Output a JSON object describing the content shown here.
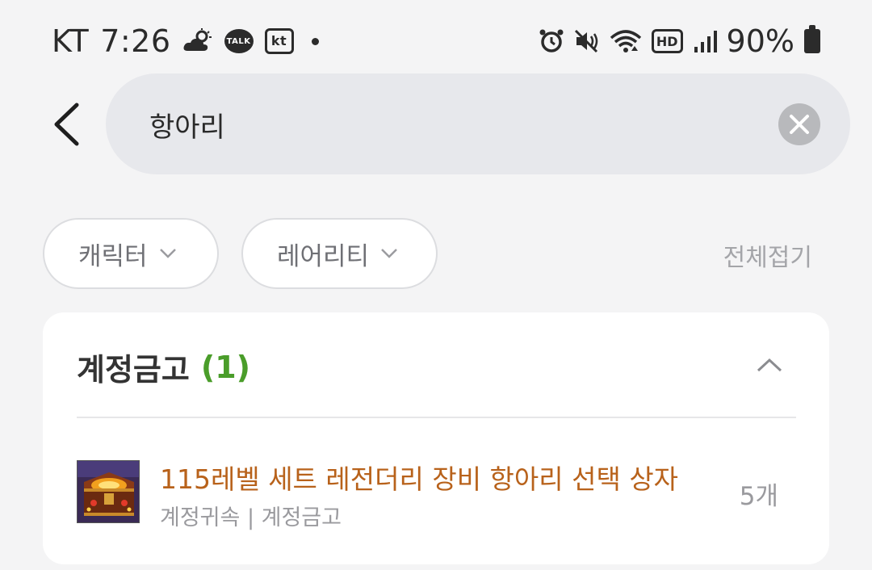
{
  "status_bar": {
    "carrier": "KT",
    "time": "7:26",
    "talk_label": "TALK",
    "kt_label": "kt",
    "hd_label": "HD",
    "battery": "90%",
    "icons": [
      "weather-icon",
      "kakaotalk-icon",
      "kt-icon",
      "alarm-icon",
      "mute-icon",
      "wifi-icon",
      "hd-voice-icon",
      "signal-icon",
      "battery-icon"
    ]
  },
  "search": {
    "value": "항아리",
    "placeholder": ""
  },
  "filters": {
    "character_label": "캐릭터",
    "rarity_label": "레어리티",
    "collapse_all_label": "전체접기"
  },
  "section": {
    "title": "계정금고",
    "count": "(1)",
    "items": [
      {
        "name": "115레벨 세트 레전더리 장비 항아리 선택 상자",
        "sub": "계정귀속 | 계정금고",
        "qty": "5개",
        "icon": "treasure-chest-icon"
      }
    ]
  },
  "colors": {
    "background": "#f4f4f5",
    "search_bg": "#e7e8ec",
    "count_green": "#4a9d2a",
    "legendary_orange": "#b8621b",
    "muted": "#9a9a9e"
  }
}
